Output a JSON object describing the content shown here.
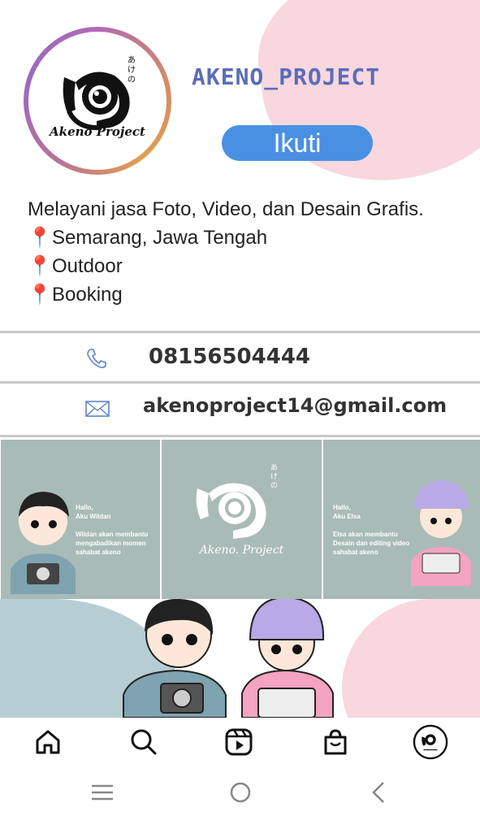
{
  "profile": {
    "username": "AKENO_PROJECT",
    "follow_label": "Ikuti",
    "logo_brand": "Akeno Project",
    "logo_jp": "あけの"
  },
  "bio": {
    "line1": "Melayani jasa Foto, Video, dan Desain Grafis.",
    "line2": "Semarang, Jawa Tengah",
    "line3": "Outdoor",
    "line4": "Booking",
    "pin": "📍"
  },
  "contacts": {
    "phone": "08156504444",
    "email": "akenoproject14@gmail.com"
  },
  "posts": {
    "tile1": "Hallo,\nAku Wildan\n\nWildan akan membantu\nmengabadikan momen\nsahabat akeno",
    "tile2_brand": "Akeno. Project",
    "tile2_jp": "あけの",
    "tile3": "Hallo,\nAku Elsa\n\nElsa akan membantu\nDesain dan editing video\nsahabat akeno"
  },
  "colors": {
    "accent": "#4a90e2",
    "username": "#5a6db8",
    "pink": "#f8d7df",
    "sage": "#a9bbb6",
    "blue_wave": "#b6cdd4"
  },
  "nav": {
    "items": [
      "home-icon",
      "search-icon",
      "reels-icon",
      "shop-icon",
      "profile-avatar"
    ]
  }
}
